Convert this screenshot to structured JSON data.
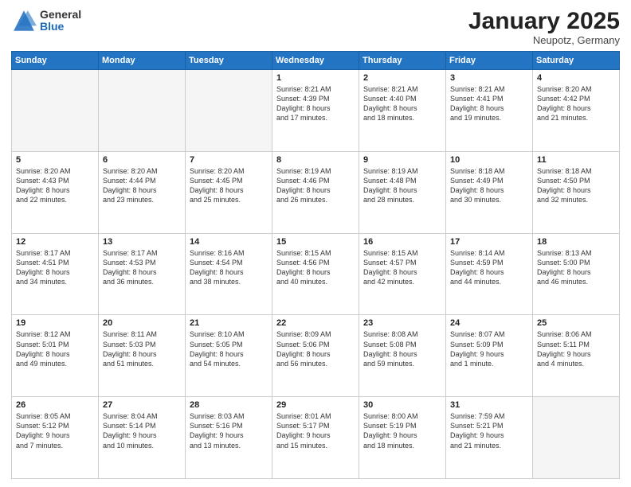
{
  "logo": {
    "general": "General",
    "blue": "Blue"
  },
  "header": {
    "month": "January 2025",
    "location": "Neupotz, Germany"
  },
  "days_header": [
    "Sunday",
    "Monday",
    "Tuesday",
    "Wednesday",
    "Thursday",
    "Friday",
    "Saturday"
  ],
  "weeks": [
    [
      {
        "day": "",
        "info": ""
      },
      {
        "day": "",
        "info": ""
      },
      {
        "day": "",
        "info": ""
      },
      {
        "day": "1",
        "info": "Sunrise: 8:21 AM\nSunset: 4:39 PM\nDaylight: 8 hours\nand 17 minutes."
      },
      {
        "day": "2",
        "info": "Sunrise: 8:21 AM\nSunset: 4:40 PM\nDaylight: 8 hours\nand 18 minutes."
      },
      {
        "day": "3",
        "info": "Sunrise: 8:21 AM\nSunset: 4:41 PM\nDaylight: 8 hours\nand 19 minutes."
      },
      {
        "day": "4",
        "info": "Sunrise: 8:20 AM\nSunset: 4:42 PM\nDaylight: 8 hours\nand 21 minutes."
      }
    ],
    [
      {
        "day": "5",
        "info": "Sunrise: 8:20 AM\nSunset: 4:43 PM\nDaylight: 8 hours\nand 22 minutes."
      },
      {
        "day": "6",
        "info": "Sunrise: 8:20 AM\nSunset: 4:44 PM\nDaylight: 8 hours\nand 23 minutes."
      },
      {
        "day": "7",
        "info": "Sunrise: 8:20 AM\nSunset: 4:45 PM\nDaylight: 8 hours\nand 25 minutes."
      },
      {
        "day": "8",
        "info": "Sunrise: 8:19 AM\nSunset: 4:46 PM\nDaylight: 8 hours\nand 26 minutes."
      },
      {
        "day": "9",
        "info": "Sunrise: 8:19 AM\nSunset: 4:48 PM\nDaylight: 8 hours\nand 28 minutes."
      },
      {
        "day": "10",
        "info": "Sunrise: 8:18 AM\nSunset: 4:49 PM\nDaylight: 8 hours\nand 30 minutes."
      },
      {
        "day": "11",
        "info": "Sunrise: 8:18 AM\nSunset: 4:50 PM\nDaylight: 8 hours\nand 32 minutes."
      }
    ],
    [
      {
        "day": "12",
        "info": "Sunrise: 8:17 AM\nSunset: 4:51 PM\nDaylight: 8 hours\nand 34 minutes."
      },
      {
        "day": "13",
        "info": "Sunrise: 8:17 AM\nSunset: 4:53 PM\nDaylight: 8 hours\nand 36 minutes."
      },
      {
        "day": "14",
        "info": "Sunrise: 8:16 AM\nSunset: 4:54 PM\nDaylight: 8 hours\nand 38 minutes."
      },
      {
        "day": "15",
        "info": "Sunrise: 8:15 AM\nSunset: 4:56 PM\nDaylight: 8 hours\nand 40 minutes."
      },
      {
        "day": "16",
        "info": "Sunrise: 8:15 AM\nSunset: 4:57 PM\nDaylight: 8 hours\nand 42 minutes."
      },
      {
        "day": "17",
        "info": "Sunrise: 8:14 AM\nSunset: 4:59 PM\nDaylight: 8 hours\nand 44 minutes."
      },
      {
        "day": "18",
        "info": "Sunrise: 8:13 AM\nSunset: 5:00 PM\nDaylight: 8 hours\nand 46 minutes."
      }
    ],
    [
      {
        "day": "19",
        "info": "Sunrise: 8:12 AM\nSunset: 5:01 PM\nDaylight: 8 hours\nand 49 minutes."
      },
      {
        "day": "20",
        "info": "Sunrise: 8:11 AM\nSunset: 5:03 PM\nDaylight: 8 hours\nand 51 minutes."
      },
      {
        "day": "21",
        "info": "Sunrise: 8:10 AM\nSunset: 5:05 PM\nDaylight: 8 hours\nand 54 minutes."
      },
      {
        "day": "22",
        "info": "Sunrise: 8:09 AM\nSunset: 5:06 PM\nDaylight: 8 hours\nand 56 minutes."
      },
      {
        "day": "23",
        "info": "Sunrise: 8:08 AM\nSunset: 5:08 PM\nDaylight: 8 hours\nand 59 minutes."
      },
      {
        "day": "24",
        "info": "Sunrise: 8:07 AM\nSunset: 5:09 PM\nDaylight: 9 hours\nand 1 minute."
      },
      {
        "day": "25",
        "info": "Sunrise: 8:06 AM\nSunset: 5:11 PM\nDaylight: 9 hours\nand 4 minutes."
      }
    ],
    [
      {
        "day": "26",
        "info": "Sunrise: 8:05 AM\nSunset: 5:12 PM\nDaylight: 9 hours\nand 7 minutes."
      },
      {
        "day": "27",
        "info": "Sunrise: 8:04 AM\nSunset: 5:14 PM\nDaylight: 9 hours\nand 10 minutes."
      },
      {
        "day": "28",
        "info": "Sunrise: 8:03 AM\nSunset: 5:16 PM\nDaylight: 9 hours\nand 13 minutes."
      },
      {
        "day": "29",
        "info": "Sunrise: 8:01 AM\nSunset: 5:17 PM\nDaylight: 9 hours\nand 15 minutes."
      },
      {
        "day": "30",
        "info": "Sunrise: 8:00 AM\nSunset: 5:19 PM\nDaylight: 9 hours\nand 18 minutes."
      },
      {
        "day": "31",
        "info": "Sunrise: 7:59 AM\nSunset: 5:21 PM\nDaylight: 9 hours\nand 21 minutes."
      },
      {
        "day": "",
        "info": ""
      }
    ]
  ]
}
